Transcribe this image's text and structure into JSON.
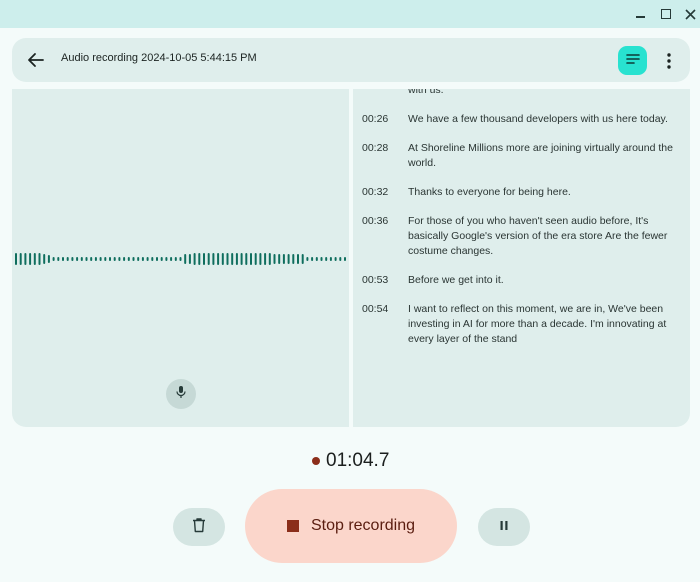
{
  "window": {
    "minimize_icon": "minimize-icon",
    "maximize_icon": "maximize-icon",
    "close_icon": "close-icon"
  },
  "header": {
    "title": "Audio recording 2024-10-05 5:44:15 PM",
    "back_icon": "arrow-back-icon",
    "transcript_icon": "transcript-icon",
    "more_icon": "more-vert-icon"
  },
  "transcript": [
    {
      "time": "",
      "text": "with us."
    },
    {
      "time": "00:26",
      "text": "We have a few thousand developers with us here today."
    },
    {
      "time": "00:28",
      "text": "At Shoreline Millions more are joining virtually around the world."
    },
    {
      "time": "00:32",
      "text": "Thanks to everyone for being here."
    },
    {
      "time": "00:36",
      "text": "For those of you who haven't seen audio before, It's basically Google's version of the era store Are the fewer costume changes."
    },
    {
      "time": "00:53",
      "text": "Before we get into it."
    },
    {
      "time": "00:54",
      "text": "I want to reflect on this moment, we are in, We've been investing in AI for more than a decade. I'm innovating at every layer of the stand"
    }
  ],
  "recorder": {
    "mic_icon": "mic-icon",
    "elapsed": "01:04.7",
    "delete_icon": "delete-icon",
    "stop_label": "Stop recording",
    "pause_icon": "pause-icon"
  },
  "colors": {
    "accent": "#28e2d0",
    "wave": "#0f6e5e",
    "record_red": "#8b2e1a",
    "stop_bg": "#fbd6cb"
  }
}
